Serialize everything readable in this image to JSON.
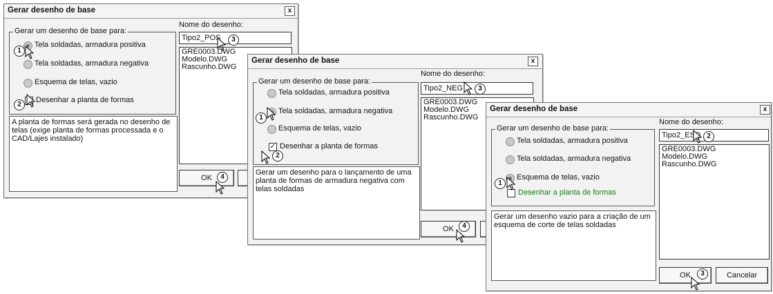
{
  "d1": {
    "title": "Gerar desenho de base",
    "close": "x",
    "group_label": "Gerar um desenho de base para:",
    "opt1": "Tela soldadas, armadura positiva",
    "opt2": "Tela soldadas, armadura negativa",
    "opt3": "Esquema de telas, vazio",
    "checkbox": "Desenhar a planta de formas",
    "description": "A planta de formas será gerada no desenho de telas (exige planta de formas processada e o CAD/Lajes instalado)",
    "name_label": "Nome do desenho:",
    "name_value": "Tipo2_POS",
    "list": [
      "GRE0003.DWG",
      "Modelo.DWG",
      "Rascunho.DWG"
    ],
    "ok": "OK",
    "steps": [
      "1",
      "2",
      "3",
      "4"
    ]
  },
  "d2": {
    "title": "Gerar desenho de base",
    "close": "x",
    "group_label": "Gerar um desenho de base para:",
    "opt1": "Tela soldadas, armadura positiva",
    "opt2": "Tela soldadas, armadura negativa",
    "opt3": "Esquema de telas, vazio",
    "checkbox": "Desenhar a planta de formas",
    "description": "Gerar um desenho para o lançamento de uma planta de formas de armadura negativa com telas soldadas",
    "name_label": "Nome do desenho:",
    "name_value": "Tipo2_NEG",
    "list": [
      "GRE0003.DWG",
      "Modelo.DWG",
      "Rascunho.DWG"
    ],
    "ok": "OK",
    "steps": [
      "1",
      "2",
      "3",
      "4"
    ]
  },
  "d3": {
    "title": "Gerar desenho de base",
    "close": "x",
    "group_label": "Gerar um desenho de base para:",
    "opt1": "Tela soldadas, armadura positiva",
    "opt2": "Tela soldadas, armadura negativa",
    "opt3": "Esquema de telas, vazio",
    "checkbox": "Desenhar a planta de formas",
    "description": "Gerar um desenho vazio para a criação de um esquema de corte de telas soldadas",
    "name_label": "Nome do desenho:",
    "name_value": "Tipo2_ESQ",
    "list": [
      "GRE0003.DWG",
      "Modelo.DWG",
      "Rascunho.DWG"
    ],
    "ok": "OK",
    "cancel": "Cancelar",
    "steps": [
      "1",
      "2",
      "3"
    ]
  },
  "colors": {
    "disabled_green": "#1a7a1a",
    "radio_gray": "#c9c9c9"
  }
}
